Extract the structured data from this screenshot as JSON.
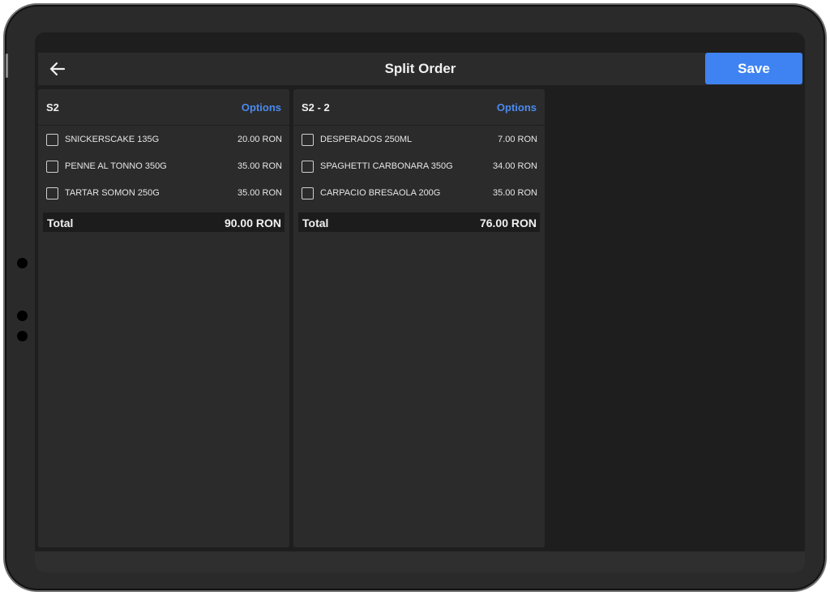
{
  "header": {
    "title": "Split Order",
    "save_label": "Save"
  },
  "panels": [
    {
      "name": "S2",
      "options_label": "Options",
      "items": [
        {
          "name": "SNICKERSCAKE 135G",
          "price": "20.00 RON"
        },
        {
          "name": "PENNE AL TONNO 350G",
          "price": "35.00 RON"
        },
        {
          "name": "TARTAR SOMON 250G",
          "price": "35.00 RON"
        }
      ],
      "total_label": "Total",
      "total_value": "90.00 RON"
    },
    {
      "name": "S2 - 2",
      "options_label": "Options",
      "items": [
        {
          "name": "DESPERADOS 250ML",
          "price": "7.00 RON"
        },
        {
          "name": "SPAGHETTI CARBONARA 350G",
          "price": "34.00 RON"
        },
        {
          "name": "CARPACIO BRESAOLA 200G",
          "price": "35.00 RON"
        }
      ],
      "total_label": "Total",
      "total_value": "76.00 RON"
    }
  ],
  "colors": {
    "accent": "#3f83f2",
    "options_link": "#4b8af0",
    "panel_bg": "#2b2b2b",
    "screen_bg": "#1e1e1e"
  },
  "icons": {
    "back": "arrow-left-icon",
    "checkbox": "checkbox-unchecked-icon"
  }
}
